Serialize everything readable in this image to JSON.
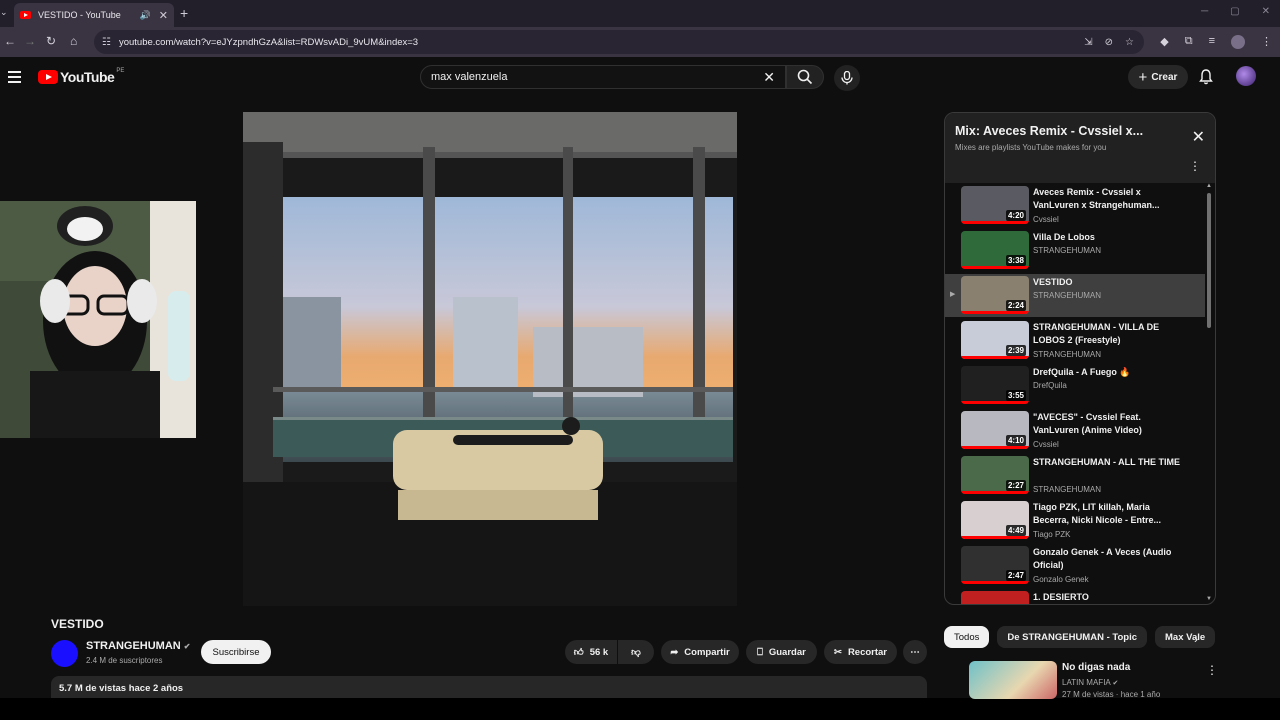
{
  "browser": {
    "tab_title": "VESTIDO - YouTube",
    "url": "youtube.com/watch?v=eJYzpndhGzA&list=RDWsvADi_9vUM&index=3"
  },
  "youtube": {
    "logo_text": "YouTube",
    "country_code": "PE",
    "search_value": "max valenzuela",
    "create_label": "Crear"
  },
  "video": {
    "title": "VESTIDO",
    "channel": "STRANGEHUMAN",
    "subscribers": "2.4 M de suscriptores",
    "subscribe_label": "Suscribirse",
    "likes": "56 k",
    "share_label": "Compartir",
    "save_label": "Guardar",
    "clip_label": "Recortar",
    "views_date": "5.7 M de vistas  hace 2 años"
  },
  "playlist": {
    "title": "Mix: Aveces Remix - Cvssiel x...",
    "subtitle": "Mixes are playlists YouTube makes for you",
    "items": [
      {
        "title": "Aveces Remix - Cvssiel x VanLvuren x Strangehuman...",
        "channel": "Cvssiel",
        "duration": "4:20",
        "active": false
      },
      {
        "title": "Villa De Lobos",
        "channel": "STRANGEHUMAN",
        "duration": "3:38",
        "active": false
      },
      {
        "title": "VESTIDO",
        "channel": "STRANGEHUMAN",
        "duration": "2:24",
        "active": true
      },
      {
        "title": "STRANGEHUMAN - VILLA DE LOBOS 2 (Freestyle)",
        "channel": "STRANGEHUMAN",
        "duration": "2:39",
        "active": false
      },
      {
        "title": "DrefQuila - A Fuego 🔥",
        "channel": "DrefQuila",
        "duration": "3:55",
        "active": false
      },
      {
        "title": "\"AVECES\" - Cvssiel Feat. VanLvuren (Anime Video)",
        "channel": "Cvssiel",
        "duration": "4:10",
        "active": false
      },
      {
        "title": "STRANGEHUMAN - ALL THE TIME",
        "channel": "STRANGEHUMAN",
        "duration": "2:27",
        "active": false
      },
      {
        "title": "Tiago PZK, LIT killah, Maria Becerra, Nicki Nicole - Entre...",
        "channel": "Tiago PZK",
        "duration": "4:49",
        "active": false
      },
      {
        "title": "Gonzalo Genek - A Veces (Audio Oficial)",
        "channel": "Gonzalo Genek",
        "duration": "2:47",
        "active": false
      },
      {
        "title": "1. DESIERTO",
        "channel": "",
        "duration": "",
        "active": false
      }
    ]
  },
  "chips": [
    "Todos",
    "De STRANGEHUMAN - Topic",
    "Max Vale"
  ],
  "recommendation": {
    "title": "No digas nada",
    "channel": "LATIN MAFIA",
    "meta": "27 M de vistas · hace 1 año"
  },
  "colors": {
    "youtube_red": "#ff0000",
    "page_bg": "#0f0f0f",
    "browser_frame": "#3a3442"
  }
}
